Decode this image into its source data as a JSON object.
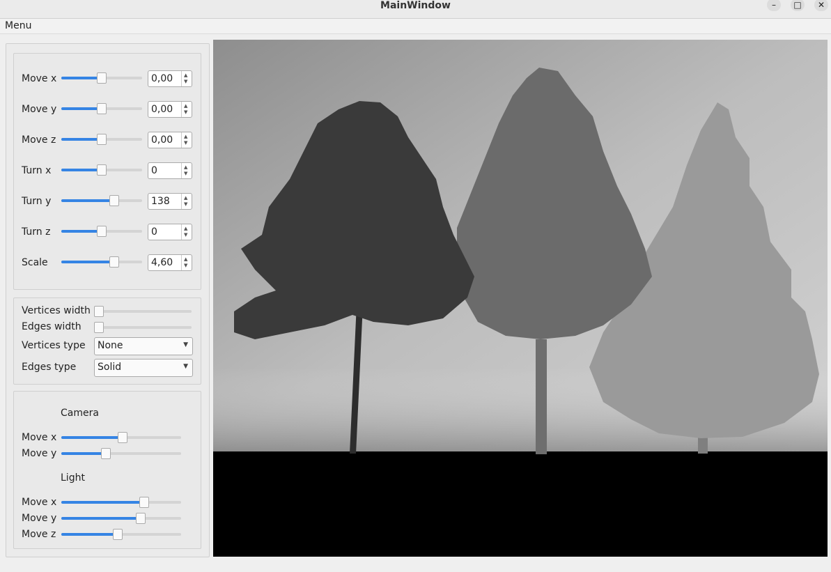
{
  "window": {
    "title": "MainWindow",
    "minimize_glyph": "–",
    "maximize_glyph": "□",
    "close_glyph": "✕"
  },
  "menubar": {
    "menu_label": "Menu"
  },
  "transform": {
    "move_x": {
      "label": "Move x",
      "value": "0,00",
      "level": 0.5
    },
    "move_y": {
      "label": "Move y",
      "value": "0,00",
      "level": 0.5
    },
    "move_z": {
      "label": "Move z",
      "value": "0,00",
      "level": 0.5
    },
    "turn_x": {
      "label": "Turn x",
      "value": "0",
      "level": 0.5
    },
    "turn_y": {
      "label": "Turn y",
      "value": "138",
      "level": 0.68
    },
    "turn_z": {
      "label": "Turn z",
      "value": "0",
      "level": 0.5
    },
    "scale": {
      "label": "Scale",
      "value": "4,60",
      "level": 0.68
    }
  },
  "appearance": {
    "vertices_width": {
      "label": "Vertices width",
      "level": 0.0
    },
    "edges_width": {
      "label": "Edges width",
      "level": 0.0
    },
    "vertices_type": {
      "label": "Vertices type",
      "value": "None"
    },
    "edges_type": {
      "label": "Edges type",
      "value": "Solid"
    }
  },
  "camera": {
    "title": "Camera",
    "move_x": {
      "label": "Move x",
      "level": 0.51
    },
    "move_y": {
      "label": "Move y",
      "level": 0.36
    }
  },
  "light": {
    "title": "Light",
    "move_x": {
      "label": "Move x",
      "level": 0.71
    },
    "move_y": {
      "label": "Move y",
      "level": 0.68
    },
    "move_z": {
      "label": "Move z",
      "level": 0.47
    }
  },
  "colors": {
    "accent": "#3584e4",
    "scene_ground": "#000000"
  },
  "icons": [
    "chevron-up-icon",
    "chevron-down-icon",
    "dropdown-arrow-icon",
    "minimize-icon",
    "maximize-icon",
    "close-icon"
  ]
}
